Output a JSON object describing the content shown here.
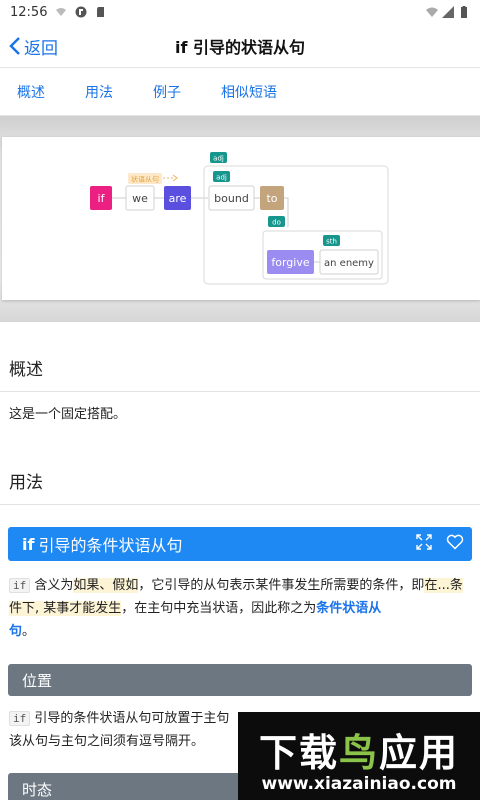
{
  "status": {
    "time": "12:56"
  },
  "nav": {
    "back_label": "返回",
    "title_bold": "if",
    "title_rest": " 引导的状语从句"
  },
  "tabs": [
    "概述",
    "用法",
    "例子",
    "相似短语"
  ],
  "diagram": {
    "if": "if",
    "we": "we",
    "are": "are",
    "bound": "bound",
    "to": "to",
    "forgive": "forgive",
    "an_enemy": "an enemy",
    "tag_adj1": "adj",
    "tag_adj2": "adj",
    "tag_do": "do",
    "tag_sth": "sth",
    "arrow_label": "状语从句"
  },
  "overview": {
    "heading": "概述",
    "text": "这是一个固定搭配。"
  },
  "usage": {
    "heading": "用法",
    "bar_bold": "if",
    "bar_rest": "引导的条件状语从句",
    "p1": {
      "code": "if",
      "t1": "含义为",
      "h1": "如果、假如",
      "t2": "，它引导的从句表示某件事发生所需要的条件，即",
      "h2": "在...条件下, 某事才能发生",
      "t3": "，在主句中充当状语，因此称之为",
      "link": "条件状语从",
      "link2": "句",
      "t4": "。"
    },
    "position_label": "位置",
    "p2": {
      "code": "if",
      "t1": "引导的条件状语从句可放置于主句",
      "t2": "该从句与主句之间须有逗号隔开。"
    },
    "tense_label": "时态"
  },
  "watermark": {
    "top_white": "下载",
    "top_green": "鸟",
    "top_white2": "应用",
    "url": "www.xiazainiao.com"
  },
  "colors": {
    "accent": "#1a73e8",
    "bar_blue": "#1e88f3",
    "bar_gray": "#6c7782",
    "if_pink": "#ec1f82",
    "are_purple": "#5b4fe0",
    "to_tan": "#c4a47c",
    "forgive_lav": "#9b8cf2",
    "teal_tag": "#16968c"
  }
}
